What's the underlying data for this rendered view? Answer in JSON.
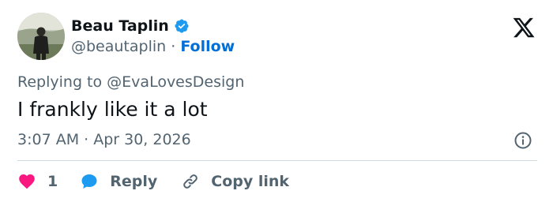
{
  "author": {
    "name": "Beau Taplin",
    "handle": "@beautaplin",
    "separator": "·",
    "follow_label": "Follow"
  },
  "tweet": {
    "replying_to_prefix": "Replying to",
    "replying_to_handle": "@EvaLovesDesign",
    "text": "I frankly like it a lot",
    "timestamp": "3:07 AM · Apr 30, 2026"
  },
  "actions": {
    "like_count": "1",
    "reply_label": "Reply",
    "copy_link_label": "Copy link"
  },
  "colors": {
    "accent_blue": "#1d9bf0",
    "follow_blue": "#006fd6",
    "like_pink": "#f91880",
    "muted_text": "#536471",
    "primary_text": "#0f1419",
    "divider": "#cfd9de"
  },
  "icons": {
    "verified": "verified-badge-icon",
    "brand": "x-logo-icon",
    "info": "info-icon",
    "like": "heart-icon",
    "reply": "speech-bubble-icon",
    "copy": "link-icon"
  }
}
